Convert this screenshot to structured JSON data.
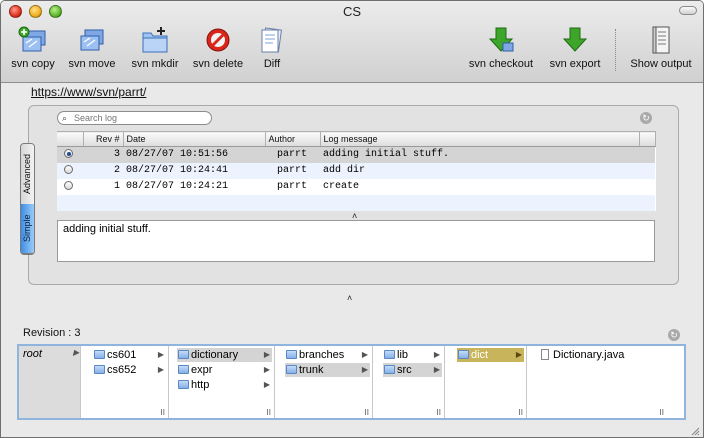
{
  "window": {
    "title": "CS"
  },
  "toolbar": {
    "left": [
      {
        "id": "svn-copy",
        "label": "svn copy",
        "icon": "copy-icon"
      },
      {
        "id": "svn-move",
        "label": "svn move",
        "icon": "move-icon"
      },
      {
        "id": "svn-mkdir",
        "label": "svn mkdir",
        "icon": "new-folder-icon"
      },
      {
        "id": "svn-delete",
        "label": "svn delete",
        "icon": "delete-icon"
      },
      {
        "id": "diff",
        "label": "Diff",
        "icon": "diff-icon"
      }
    ],
    "right": [
      {
        "id": "svn-checkout",
        "label": "svn checkout",
        "icon": "checkout-icon"
      },
      {
        "id": "svn-export",
        "label": "svn export",
        "icon": "export-icon"
      },
      {
        "id": "show-output",
        "label": "Show output",
        "icon": "output-icon"
      }
    ]
  },
  "repo": {
    "url": "https://www/svn/parrt/"
  },
  "log": {
    "search_placeholder": "Search log",
    "tabs": {
      "advanced": "Advanced",
      "simple": "Simple"
    },
    "columns": {
      "rev": "Rev #",
      "date": "Date",
      "author": "Author",
      "message": "Log message"
    },
    "rows": [
      {
        "rev": "3",
        "date": "08/27/07 10:51:56",
        "author": "parrt",
        "message": "adding initial stuff.",
        "selected": true
      },
      {
        "rev": "2",
        "date": "08/27/07 10:24:41",
        "author": "parrt",
        "message": "add dir",
        "selected": false
      },
      {
        "rev": "1",
        "date": "08/27/07 10:24:21",
        "author": "parrt",
        "message": "create",
        "selected": false
      }
    ],
    "selected_message": "adding initial stuff."
  },
  "revision": {
    "label": "Revision : 3",
    "columns": [
      {
        "items": [
          {
            "name": "root",
            "selected": false
          }
        ]
      },
      {
        "items": [
          {
            "name": "cs601",
            "selected": false
          },
          {
            "name": "cs652",
            "selected": false
          }
        ]
      },
      {
        "items": [
          {
            "name": "dictionary",
            "selected": true
          },
          {
            "name": "expr",
            "selected": false
          },
          {
            "name": "http",
            "selected": false
          }
        ]
      },
      {
        "items": [
          {
            "name": "branches",
            "selected": false
          },
          {
            "name": "trunk",
            "selected": true
          }
        ]
      },
      {
        "items": [
          {
            "name": "lib",
            "selected": false
          },
          {
            "name": "src",
            "selected": true
          }
        ]
      },
      {
        "items": [
          {
            "name": "dict",
            "selected": true
          }
        ]
      },
      {
        "items": [
          {
            "name": "Dictionary.java",
            "selected": false
          }
        ]
      }
    ]
  },
  "colors": {
    "selection_blue": "#3d8ee6",
    "selection_gold": "#c8b45a",
    "checkout_green": "#3ca52a"
  }
}
